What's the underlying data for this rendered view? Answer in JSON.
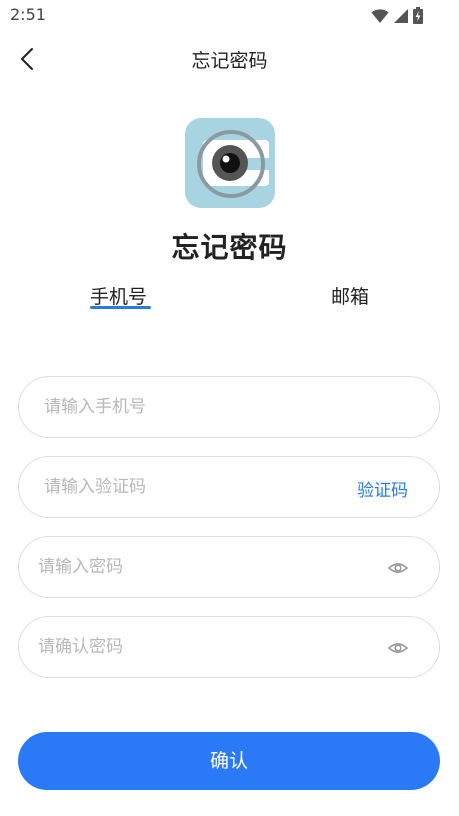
{
  "status_bar": {
    "time": "2:51",
    "icons": [
      "wifi-icon",
      "signal-icon",
      "battery-charging-icon"
    ]
  },
  "header": {
    "title": "忘记密码",
    "back_icon": "chevron-left-icon"
  },
  "logo": {
    "icon": "camera-lens-logo",
    "colors": {
      "tile": "#a8d3e0",
      "lens_ring": "#8a9aa0",
      "lens": "#555555",
      "pupil": "#111111"
    }
  },
  "page_heading": "忘记密码",
  "tabs": [
    {
      "label": "手机号",
      "active": true
    },
    {
      "label": "邮箱",
      "active": false
    }
  ],
  "form": {
    "phone_placeholder": "请输入手机号",
    "code_placeholder": "请输入验证码",
    "code_button": "验证码",
    "password_placeholder": "请输入密码",
    "confirm_password_placeholder": "请确认密码",
    "eye_icon": "eye-icon"
  },
  "submit_label": "确认",
  "colors": {
    "accent": "#2a7af8",
    "link": "#2a7ae4",
    "placeholder": "#b8b8b8",
    "field_border": "#dedede"
  }
}
